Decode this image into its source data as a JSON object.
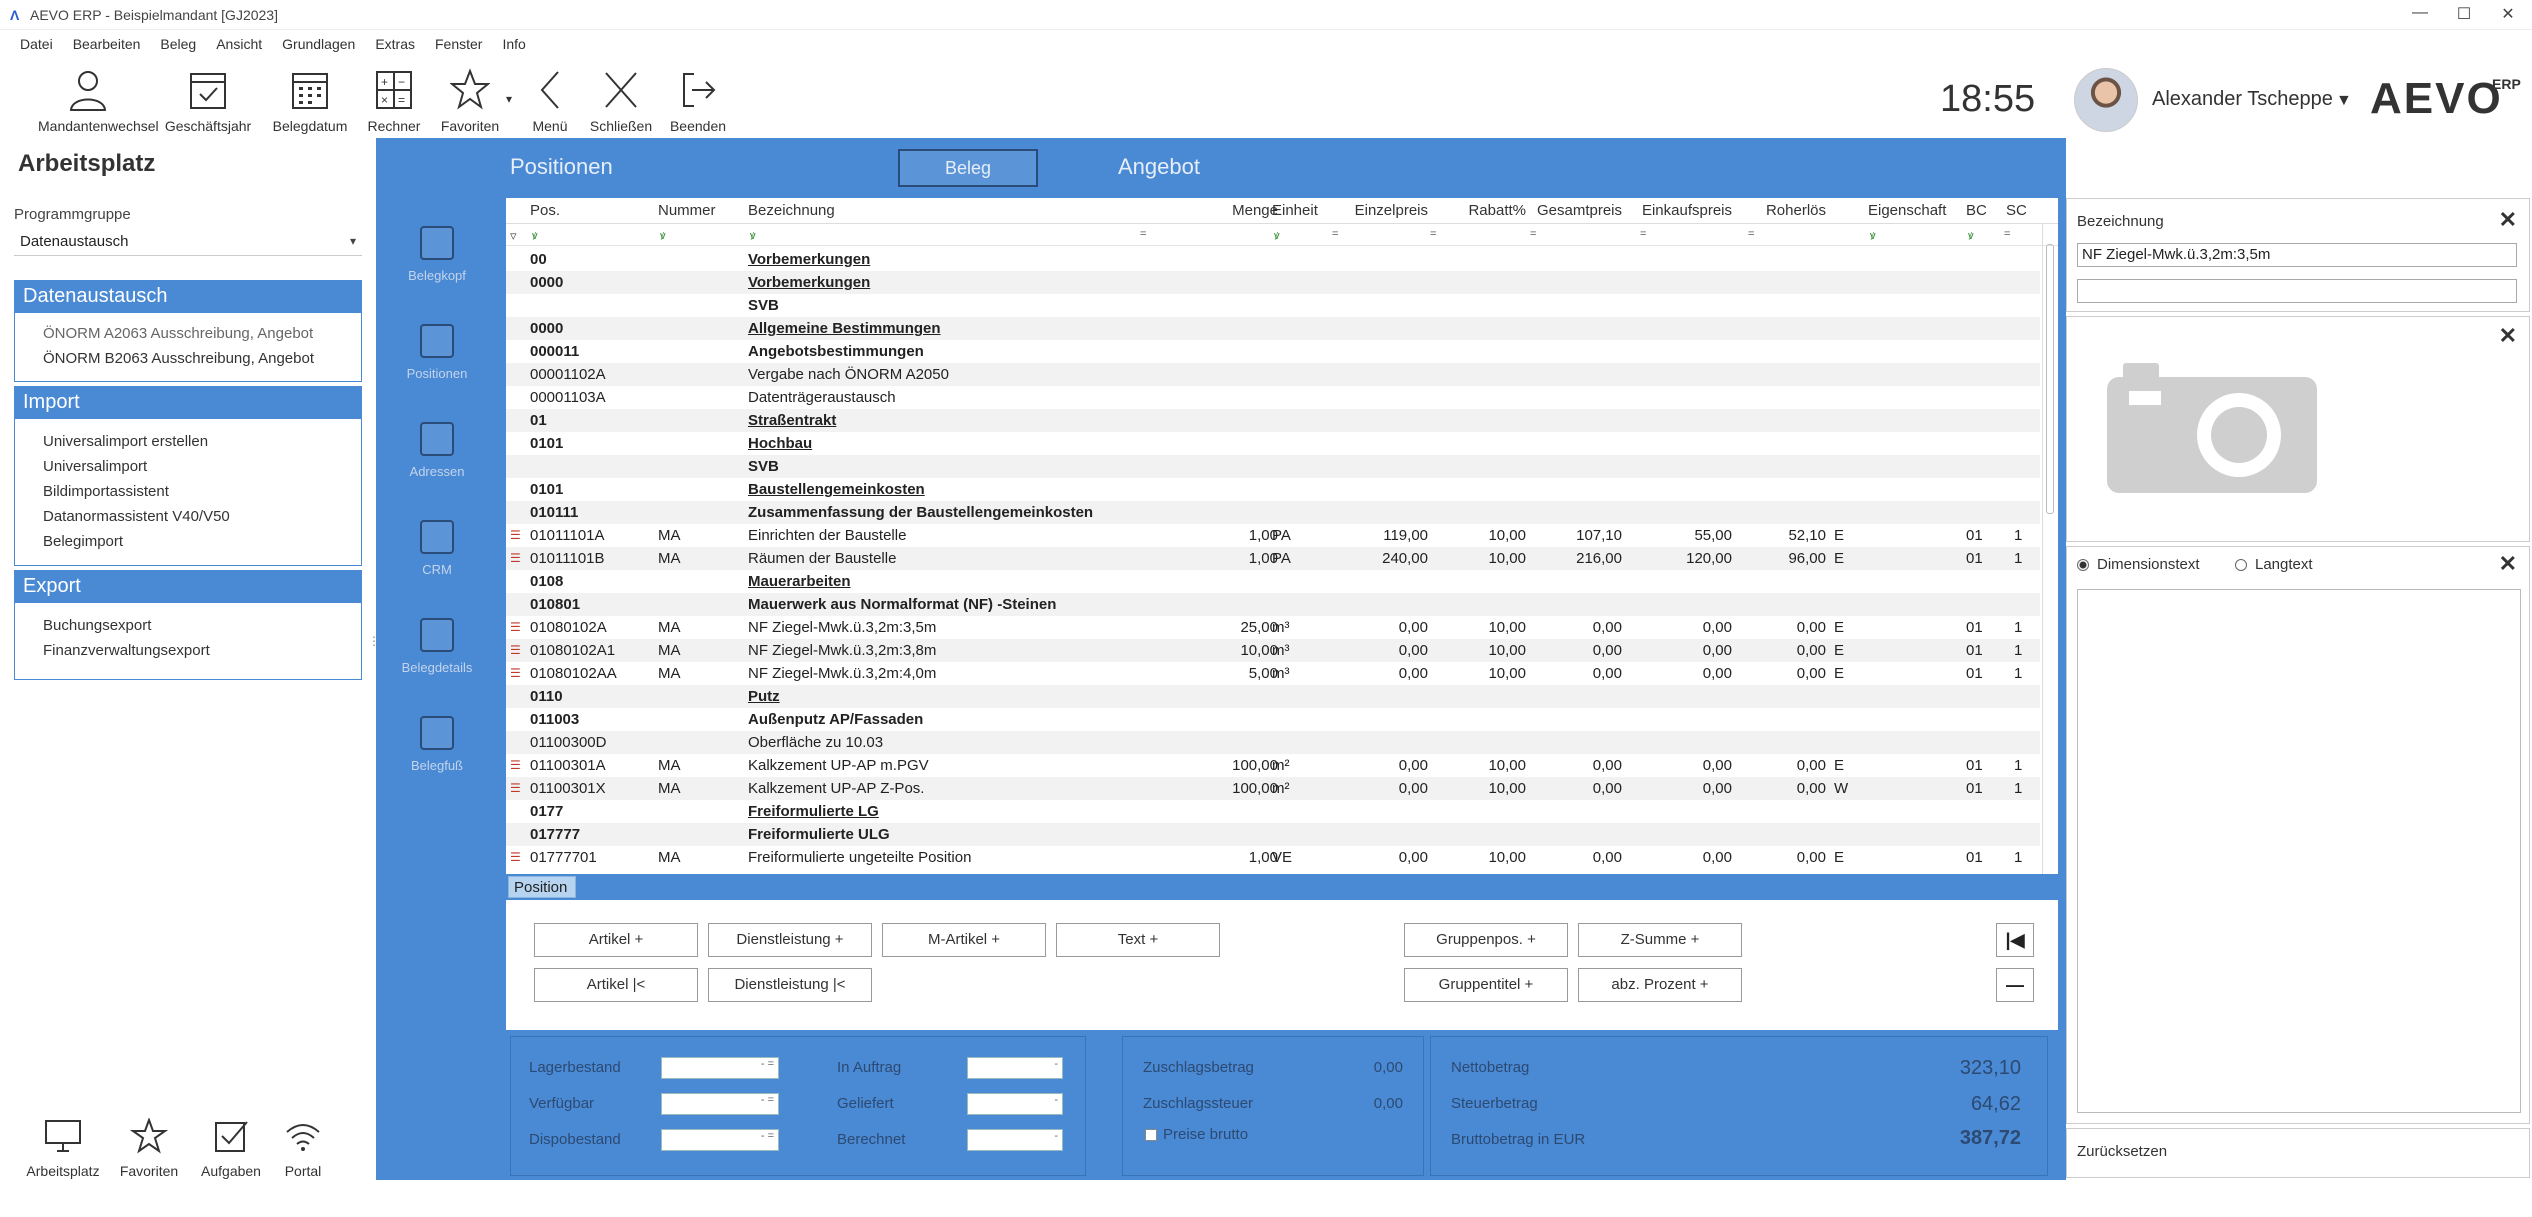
{
  "window": {
    "title": "AEVO ERP - Beispielmandant [GJ2023]",
    "logo_glyph": "Λ",
    "min": "—",
    "max": "☐",
    "close": "✕"
  },
  "menu": [
    "Datei",
    "Bearbeiten",
    "Beleg",
    "Ansicht",
    "Grundlagen",
    "Extras",
    "Fenster",
    "Info"
  ],
  "toolbar": {
    "mandantenwechsel": "Mandantenwechsel",
    "geschaeftsjahr": "Geschäftsjahr",
    "belegdatum": "Belegdatum",
    "rechner": "Rechner",
    "favoriten": "Favoriten",
    "menu": "Menü",
    "schliessen": "Schließen",
    "beenden": "Beenden"
  },
  "header": {
    "clock": "18:55",
    "user": "Alexander Tscheppe",
    "brand": "AEVO",
    "brand_sub": "ERP"
  },
  "sidebar": {
    "title": "Arbeitsplatz",
    "program_group_label": "Programmgruppe",
    "program_group_value": "Datenaustausch",
    "groups": [
      {
        "title": "Datenaustausch",
        "items": [
          "ÖNORM A2063 Ausschreibung, Angebot",
          "ÖNORM B2063 Ausschreibung, Angebot"
        ]
      },
      {
        "title": "Import",
        "items": [
          "Universalimport erstellen",
          "Universalimport",
          "Bildimportassistent",
          "Datanormassistent V40/V50",
          "Belegimport"
        ]
      },
      {
        "title": "Export",
        "items": [
          "Buchungsexport",
          "Finanzverwaltungsexport"
        ]
      }
    ],
    "bottom": {
      "arbeitsplatz": "Arbeitsplatz",
      "favoriten": "Favoriten",
      "aufgaben": "Aufgaben",
      "portal": "Portal"
    }
  },
  "main": {
    "title": "Positionen",
    "tab": "Beleg",
    "doc_type": "Angebot",
    "nav": {
      "belegkopf": "Belegkopf",
      "positionen": "Positionen",
      "adressen": "Adressen",
      "crm": "CRM",
      "belegdetails": "Belegdetails",
      "belegfuss": "Belegfuß"
    },
    "grid": {
      "columns": {
        "pos": "Pos.",
        "nummer": "Nummer",
        "bezeichnung": "Bezeichnung",
        "menge": "Menge",
        "einheit": "Einheit",
        "einzelpreis": "Einzelpreis",
        "rabatt": "Rabatt%",
        "gesamtpreis": "Gesamtpreis",
        "einkaufspreis": "Einkaufspreis",
        "rohertrag": "Roherlös",
        "eigenschaft": "Eigenschaft",
        "bc": "BC",
        "sc": "SC"
      },
      "filter_glyph": "▿",
      "filter_eq": "=",
      "filter_x": "ꝟ",
      "rows": [
        {
          "pos": "00",
          "bez": "Vorbemerkungen",
          "style": "u"
        },
        {
          "pos": "0000",
          "bez": "Vorbemerkungen",
          "style": "u"
        },
        {
          "pos": "",
          "bez": "SVB",
          "style": "b"
        },
        {
          "pos": "0000",
          "bez": "Allgemeine Bestimmungen",
          "style": "u"
        },
        {
          "pos": "000011",
          "bez": "Angebotsbestimmungen",
          "style": "b"
        },
        {
          "pos": "00001102A",
          "bez": "Vergabe nach ÖNORM A2050",
          "style": "n"
        },
        {
          "pos": "00001103A",
          "bez": "Datenträgeraustausch",
          "style": "n"
        },
        {
          "pos": "01",
          "bez": "Straßentrakt",
          "style": "u"
        },
        {
          "pos": "0101",
          "bez": "Hochbau",
          "style": "u"
        },
        {
          "pos": "",
          "bez": "SVB",
          "style": "b"
        },
        {
          "pos": "0101",
          "bez": "Baustellengemeinkosten",
          "style": "u"
        },
        {
          "pos": "010111",
          "bez": "Zusammenfassung der Baustellengemeinkosten",
          "style": "b"
        },
        {
          "pos": "01011101A",
          "nr": "MA",
          "bez": "Einrichten der Baustelle",
          "menge": "1,00",
          "einheit": "PA",
          "ep": "119,00",
          "rab": "10,00",
          "gp": "107,10",
          "ek": "55,00",
          "roh": "52,10",
          "eig": "E",
          "bc": "01",
          "sc": "1",
          "style": "n",
          "icon": true
        },
        {
          "pos": "01011101B",
          "nr": "MA",
          "bez": "Räumen der Baustelle",
          "menge": "1,00",
          "einheit": "PA",
          "ep": "240,00",
          "rab": "10,00",
          "gp": "216,00",
          "ek": "120,00",
          "roh": "96,00",
          "eig": "E",
          "bc": "01",
          "sc": "1",
          "style": "n",
          "icon": true
        },
        {
          "pos": "0108",
          "bez": "Mauerarbeiten",
          "style": "u"
        },
        {
          "pos": "010801",
          "bez": "Mauerwerk aus Normalformat (NF) -Steinen",
          "style": "b"
        },
        {
          "pos": "01080102A",
          "nr": "MA",
          "bez": "NF Ziegel-Mwk.ü.3,2m:3,5m",
          "menge": "25,00",
          "einheit": "m³",
          "ep": "0,00",
          "rab": "10,00",
          "gp": "0,00",
          "ek": "0,00",
          "roh": "0,00",
          "eig": "E",
          "bc": "01",
          "sc": "1",
          "style": "n",
          "icon": true
        },
        {
          "pos": "01080102A1",
          "nr": "MA",
          "bez": "NF Ziegel-Mwk.ü.3,2m:3,8m",
          "menge": "10,00",
          "einheit": "m³",
          "ep": "0,00",
          "rab": "10,00",
          "gp": "0,00",
          "ek": "0,00",
          "roh": "0,00",
          "eig": "E",
          "bc": "01",
          "sc": "1",
          "style": "n",
          "icon": true
        },
        {
          "pos": "01080102AA",
          "nr": "MA",
          "bez": "NF Ziegel-Mwk.ü.3,2m:4,0m",
          "menge": "5,00",
          "einheit": "m³",
          "ep": "0,00",
          "rab": "10,00",
          "gp": "0,00",
          "ek": "0,00",
          "roh": "0,00",
          "eig": "E",
          "bc": "01",
          "sc": "1",
          "style": "n",
          "icon": true
        },
        {
          "pos": "0110",
          "bez": "Putz",
          "style": "u"
        },
        {
          "pos": "011003",
          "bez": "Außenputz AP/Fassaden",
          "style": "b"
        },
        {
          "pos": "01100300D",
          "bez": "Oberfläche zu 10.03",
          "style": "n"
        },
        {
          "pos": "01100301A",
          "nr": "MA",
          "bez": "Kalkzement UP-AP m.PGV",
          "menge": "100,00",
          "einheit": "m²",
          "ep": "0,00",
          "rab": "10,00",
          "gp": "0,00",
          "ek": "0,00",
          "roh": "0,00",
          "eig": "E",
          "bc": "01",
          "sc": "1",
          "style": "n",
          "icon": true
        },
        {
          "pos": "01100301X",
          "nr": "MA",
          "bez": "Kalkzement UP-AP Z-Pos.",
          "menge": "100,00",
          "einheit": "m²",
          "ep": "0,00",
          "rab": "10,00",
          "gp": "0,00",
          "ek": "0,00",
          "roh": "0,00",
          "eig": "W",
          "bc": "01",
          "sc": "1",
          "style": "n",
          "icon": true
        },
        {
          "pos": "0177",
          "bez": "Freiformulierte LG",
          "style": "u"
        },
        {
          "pos": "017777",
          "bez": "Freiformulierte ULG",
          "style": "b"
        },
        {
          "pos": "01777701",
          "nr": "MA",
          "bez": "Freiformulierte ungeteilte Position",
          "menge": "1,00",
          "einheit": "VE",
          "ep": "0,00",
          "rab": "10,00",
          "gp": "0,00",
          "ek": "0,00",
          "roh": "0,00",
          "eig": "E",
          "bc": "01",
          "sc": "1",
          "style": "n",
          "icon": true
        }
      ]
    },
    "position_tab": "Position",
    "buttons": {
      "artikel_plus": "Artikel +",
      "dienstleistung_plus": "Dienstleistung +",
      "m_artikel_plus": "M-Artikel +",
      "text_plus": "Text +",
      "gruppenpos_plus": "Gruppenpos. +",
      "z_summe_plus": "Z-Summe +",
      "artikel_bar": "Artikel |<",
      "dienstleistung_bar": "Dienstleistung |<",
      "gruppentitel_plus": "Gruppentitel +",
      "abz_prozent_plus": "abz. Prozent +",
      "first_icon": "|◀",
      "minus_icon": "—"
    },
    "stock": {
      "lagerbestand": "Lagerbestand",
      "verfuegbar": "Verfügbar",
      "dispobestand": "Dispobestand",
      "spinner": "- ="
    },
    "order": {
      "in_auftrag": "In Auftrag",
      "geliefert": "Geliefert",
      "berechnet": "Berechnet",
      "spinner": "-"
    },
    "surcharge": {
      "zuschlagsbetrag_label": "Zuschlagsbetrag",
      "zuschlagsbetrag": "0,00",
      "zuschlagssteuer_label": "Zuschlagssteuer",
      "zuschlagssteuer": "0,00",
      "preise_brutto": "Preise brutto"
    },
    "totals": {
      "netto_label": "Nettobetrag",
      "netto": "323,10",
      "steuer_label": "Steuerbetrag",
      "steuer": "64,62",
      "brutto_label": "Bruttobetrag in EUR",
      "brutto": "387,72"
    }
  },
  "right": {
    "bezeichnung_label": "Bezeichnung",
    "bezeichnung_value": "NF Ziegel-Mwk.ü.3,2m:3,5m",
    "dimensionstext": "Dimensionstext",
    "langtext": "Langtext",
    "zuruecksetzen": "Zurücksetzen",
    "close": "✕"
  }
}
